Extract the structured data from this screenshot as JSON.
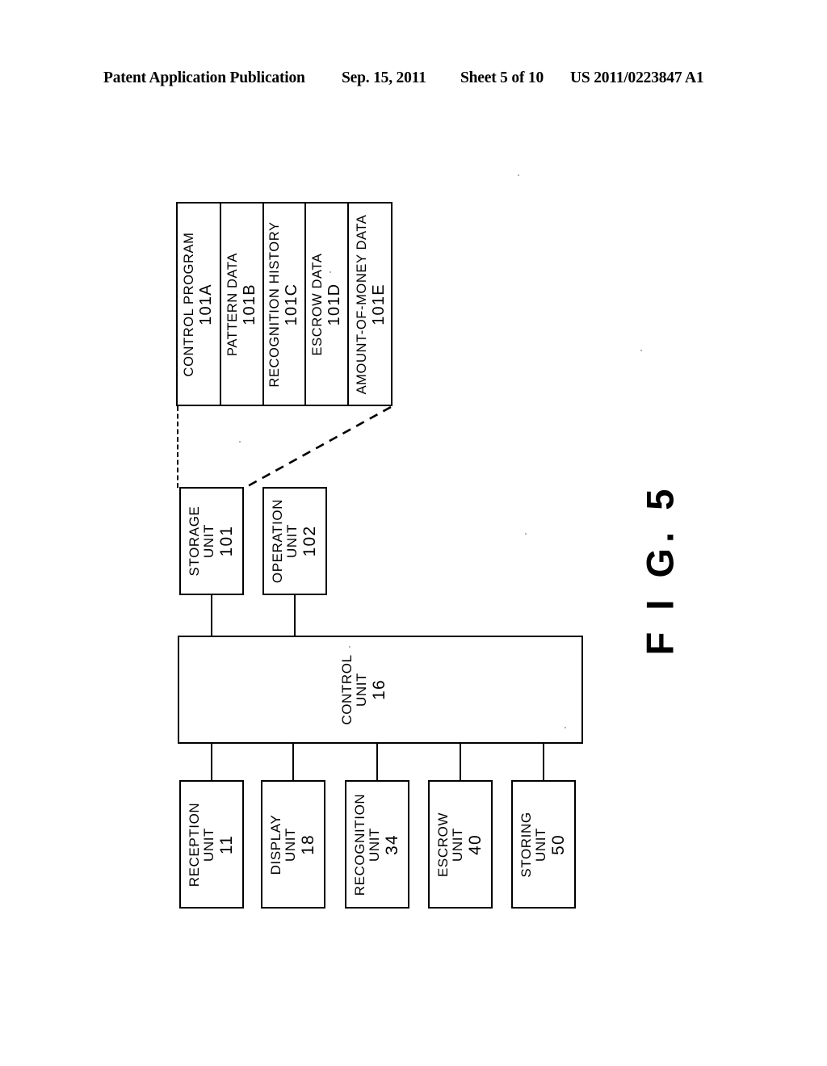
{
  "header": {
    "publication": "Patent Application Publication",
    "date": "Sep. 15, 2011",
    "sheet": "Sheet 5 of 10",
    "number": "US 2011/0223847 A1"
  },
  "figure": {
    "label": "F I G. 5",
    "storage_detail": {
      "name": "storage-unit-contents",
      "cells": [
        {
          "label": "CONTROL  PROGRAM",
          "ref": "101A"
        },
        {
          "label": "PATTERN  DATA",
          "ref": "101B"
        },
        {
          "label": "RECOGNITION  HISTORY",
          "ref": "101C"
        },
        {
          "label": "ESCROW  DATA",
          "ref": "101D"
        },
        {
          "label": "AMOUNT-OF-MONEY  DATA",
          "ref": "101E"
        }
      ]
    },
    "upper_units": [
      {
        "label_line1": "STORAGE",
        "label_line2": "UNIT",
        "ref": "101"
      },
      {
        "label_line1": "OPERATION",
        "label_line2": "UNIT",
        "ref": "102"
      }
    ],
    "control_unit": {
      "label_line1": "CONTROL",
      "label_line2": "UNIT",
      "ref": "16"
    },
    "peripheral_units": [
      {
        "label_line1": "RECEPTION",
        "label_line2": "UNIT",
        "ref": "11"
      },
      {
        "label_line1": "DISPLAY",
        "label_line2": "UNIT",
        "ref": "18"
      },
      {
        "label_line1": "RECOGNITION",
        "label_line2": "UNIT",
        "ref": "34"
      },
      {
        "label_line1": "ESCROW",
        "label_line2": "UNIT",
        "ref": "40"
      },
      {
        "label_line1": "STORING",
        "label_line2": "UNIT",
        "ref": "50"
      }
    ]
  },
  "colors": {
    "ink": "#000000",
    "paper": "#ffffff"
  }
}
